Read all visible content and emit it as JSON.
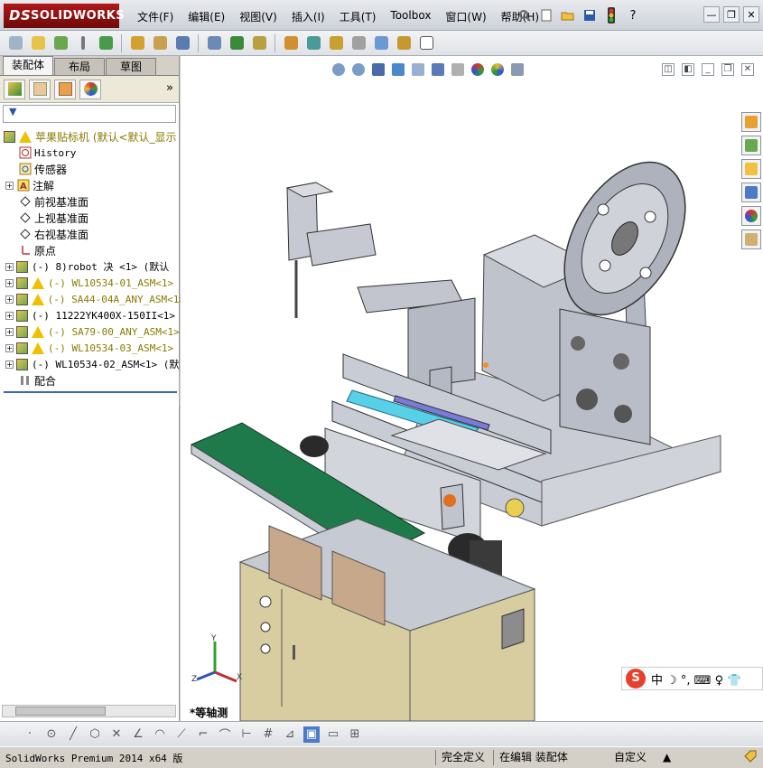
{
  "app": {
    "logo_prefix": "DS",
    "logo_text": "SOLIDWORKS",
    "brand_color": "#a01414"
  },
  "menubar": {
    "items": [
      "文件(F)",
      "编辑(E)",
      "视图(V)",
      "插入(I)",
      "工具(T)",
      "Toolbox",
      "窗口(W)",
      "帮助(H)"
    ]
  },
  "window_controls": {
    "minimize": "—",
    "restore": "❐",
    "close": "✕"
  },
  "quickbar": {
    "help": "?"
  },
  "panel": {
    "tabs": [
      "装配体",
      "布局",
      "草图"
    ],
    "active_tab": 0,
    "more": "»",
    "filter": "▼"
  },
  "tree": {
    "root": {
      "label": "苹果贴标机  (默认<默认_显示",
      "warning": true
    },
    "items": [
      {
        "label": "History",
        "mono": true
      },
      {
        "label": "传感器"
      },
      {
        "label": "注解",
        "expand": "+"
      },
      {
        "label": "前视基准面"
      },
      {
        "label": "上视基准面"
      },
      {
        "label": "右视基准面"
      },
      {
        "label": "原点"
      },
      {
        "label": "(-) 8)robot 决  <1> (默认",
        "expand": "+",
        "mono": true
      },
      {
        "label": "(-) WL10534-01_ASM<1>",
        "expand": "+",
        "warning": true,
        "mono": true,
        "olive": true
      },
      {
        "label": "(-) SA44-04A_ANY_ASM<1>",
        "expand": "+",
        "warning": true,
        "mono": true,
        "olive": true
      },
      {
        "label": "(-) 11222YK400X-150II<1>",
        "expand": "+",
        "mono": true
      },
      {
        "label": "(-) SA79-00_ANY_ASM<1>",
        "expand": "+",
        "warning": true,
        "mono": true,
        "olive": true
      },
      {
        "label": "(-) WL10534-03_ASM<1>",
        "expand": "+",
        "warning": true,
        "mono": true,
        "olive": true
      },
      {
        "label": "(-) WL10534-02_ASM<1> (默",
        "expand": "+",
        "mono": true
      },
      {
        "label": "配合"
      }
    ]
  },
  "viewport": {
    "view_label": "*等轴测",
    "triad": {
      "x": "X",
      "y": "Y",
      "z": "Z"
    },
    "ime": {
      "logo": "S",
      "text": "中 ☽ °, ⌨ ♀ 👕"
    }
  },
  "statusbar": {
    "product": "SolidWorks Premium 2014 x64 版",
    "status1": "完全定义",
    "status2": "在编辑 装配体",
    "units": "自定义",
    "units_arrow": "▲"
  },
  "colors": {
    "belt_green": "#1e7a4a",
    "rail_cyan": "#58d0e8",
    "cabinet_tan": "#d8cda0",
    "metal": "#b9bec8"
  }
}
